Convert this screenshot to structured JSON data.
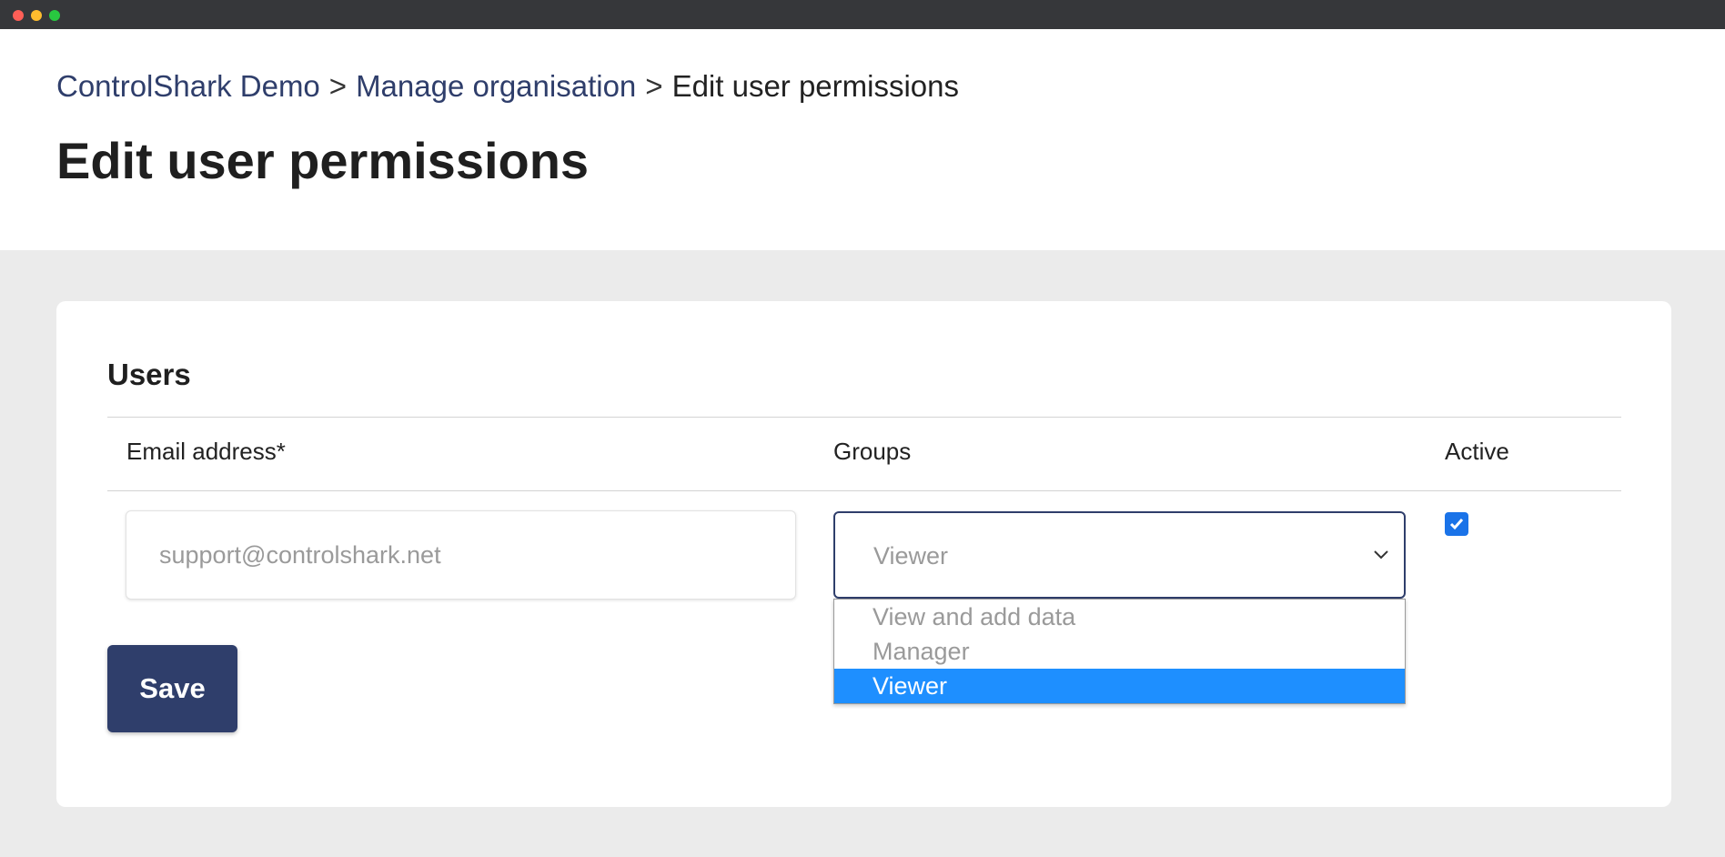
{
  "breadcrumb": {
    "items": [
      "ControlShark Demo",
      "Manage organisation",
      "Edit user permissions"
    ],
    "separator": ">"
  },
  "page": {
    "title": "Edit user permissions"
  },
  "users_section": {
    "title": "Users",
    "columns": {
      "email": "Email address*",
      "groups": "Groups",
      "active": "Active"
    },
    "row": {
      "email_placeholder": "support@controlshark.net",
      "group_selected": "Viewer",
      "group_options": [
        "View and add data",
        "Manager",
        "Viewer"
      ],
      "active": true
    },
    "save_label": "Save"
  },
  "colors": {
    "brand": "#2f3e6b",
    "highlight": "#1e8fff",
    "checkbox": "#1a73e8",
    "background": "#ebebeb"
  },
  "icons": {
    "select_chevron": "chevron-down-icon",
    "checkmark": "check-icon"
  }
}
